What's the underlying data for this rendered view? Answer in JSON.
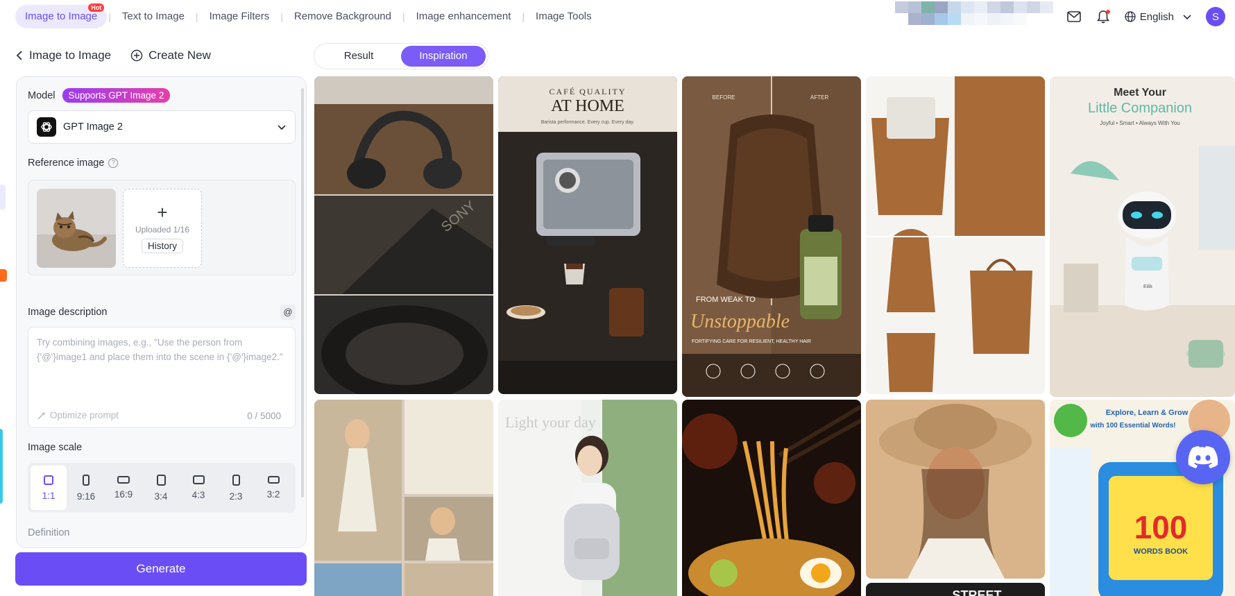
{
  "topnav": {
    "tabs": [
      {
        "label": "Image to Image",
        "badge": "Hot",
        "active": true
      },
      {
        "label": "Text to Image"
      },
      {
        "label": "Image Filters"
      },
      {
        "label": "Remove Background"
      },
      {
        "label": "Image enhancement"
      },
      {
        "label": "Image Tools"
      }
    ],
    "language": "English",
    "avatar_letter": "S",
    "icons": [
      "mail-icon",
      "bell-icon",
      "globe-icon",
      "chevron-down-icon"
    ]
  },
  "subheader": {
    "back_label": "Image to Image",
    "create_label": "Create New"
  },
  "panel": {
    "model_label": "Model",
    "model_badge": "Supports GPT Image 2",
    "model_name": "GPT Image 2",
    "reference_label": "Reference image",
    "uploaded_count": "Uploaded 1/16",
    "history_label": "History",
    "description_label": "Image description",
    "description_placeholder": "Try combining images, e.g., \"Use the person from {'@'}image1 and place them into the scene in {'@'}image2.\"",
    "at_label": "@",
    "optimize_label": "Optimize prompt",
    "char_counter": "0 / 5000",
    "scale_label": "Image scale",
    "scales": [
      {
        "label": "1:1",
        "selected": true
      },
      {
        "label": "9:16"
      },
      {
        "label": "16:9"
      },
      {
        "label": "3:4"
      },
      {
        "label": "4:3"
      },
      {
        "label": "2:3"
      },
      {
        "label": "3:2"
      }
    ],
    "definition_label": "Definition",
    "generate_label": "Generate"
  },
  "view_toggle": {
    "result_label": "Result",
    "inspiration_label": "Inspiration",
    "active": "Inspiration"
  },
  "gallery": {
    "coffee": {
      "line1": "CAFÉ QUALITY",
      "line2": "AT HOME",
      "sub": "Barista performance. Every cup. Every day."
    },
    "hair": {
      "before": "BEFORE",
      "after": "AFTER",
      "line1": "FROM WEAK TO",
      "line2": "Unstoppable",
      "line3": "FORTIFYING CARE FOR RESILIENT, HEALTHY HAIR"
    },
    "robot": {
      "line1": "Meet Your",
      "line2": "Little Companion",
      "line3": "Joyful • Smart • Always With You",
      "name": "Eilik"
    },
    "book": {
      "line1": "Explore, Learn & Grow",
      "line2": "with 100 Essential Words!",
      "big": "100",
      "sub": "WORDS BOOK"
    },
    "girl": {
      "text": "Light your day"
    },
    "street": {
      "text": "STREET"
    }
  },
  "colors": {
    "accent": "#6b4df6",
    "hot": "#ff3b3b",
    "discord": "#5865f2"
  }
}
